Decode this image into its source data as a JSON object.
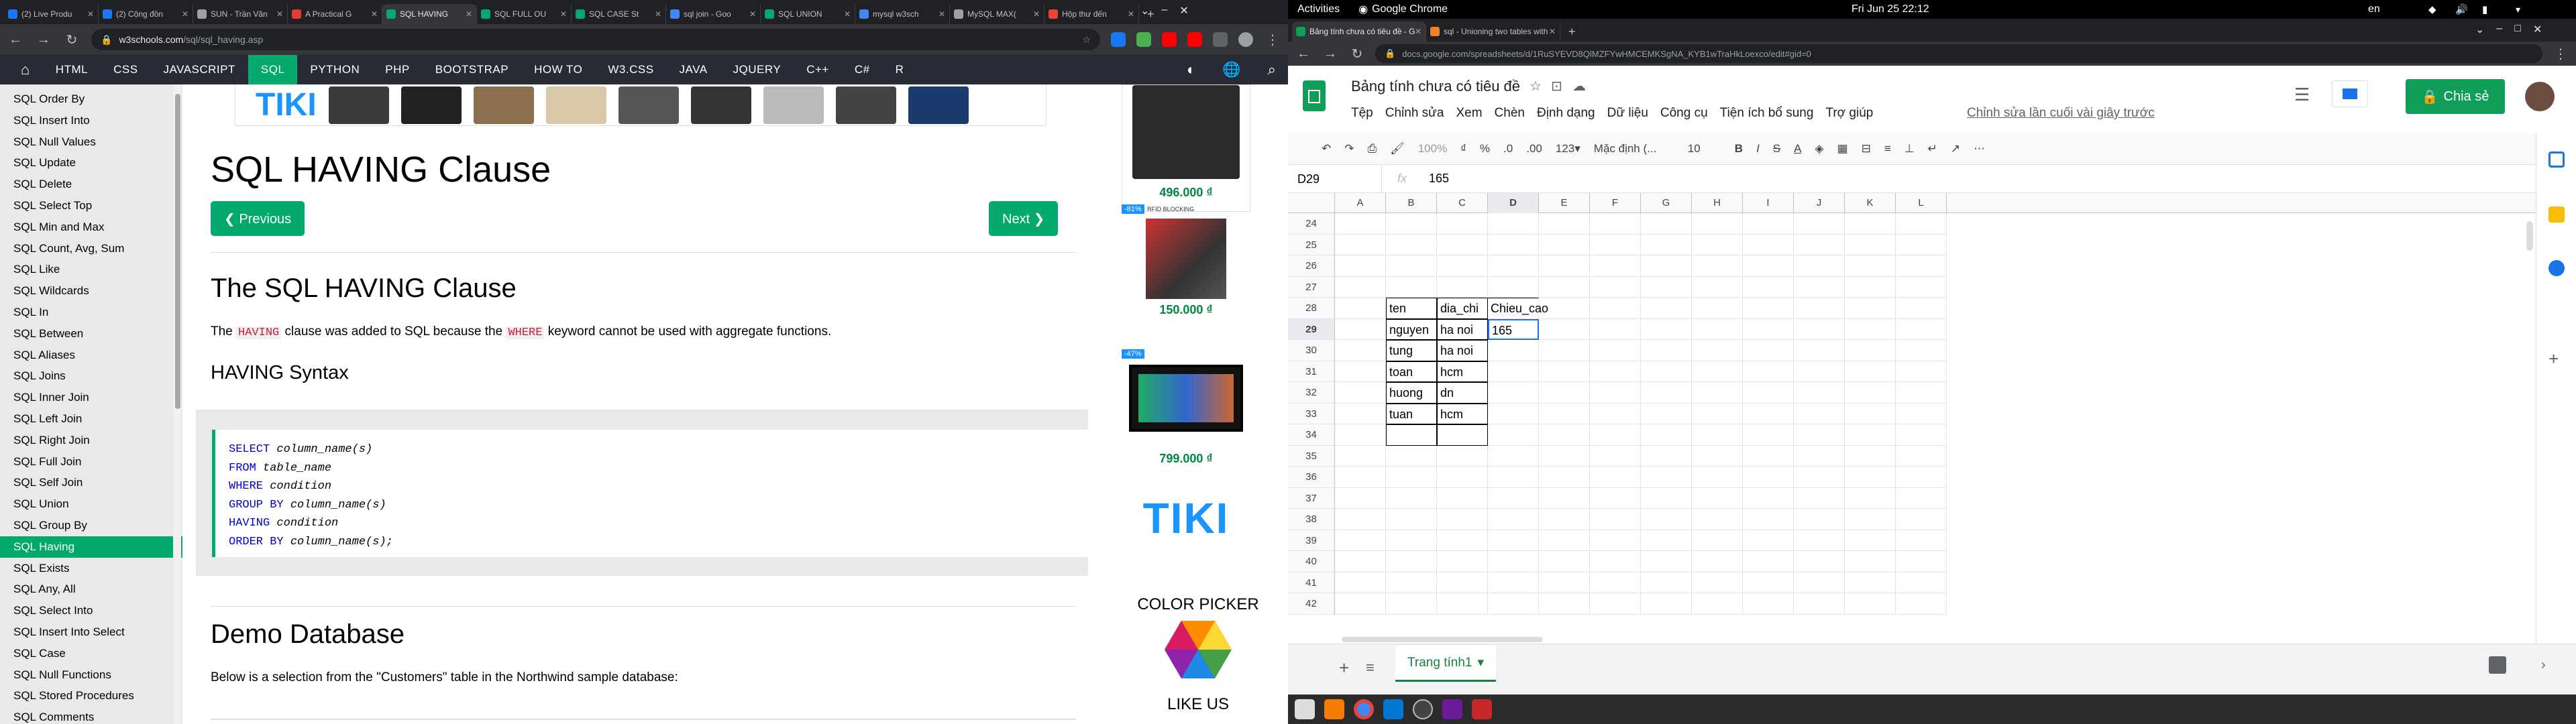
{
  "left_window": {
    "tabs": [
      {
        "title": "(2) Live Produ",
        "color": "#1877f2",
        "icon": "facebook-icon"
      },
      {
        "title": "(2) Cộng đồn",
        "color": "#1877f2",
        "icon": "facebook-icon"
      },
      {
        "title": "SUN - Trần Văn",
        "color": "#9aa0a6",
        "icon": "page-icon"
      },
      {
        "title": "A Practical G",
        "color": "#e53935",
        "icon": "article-icon"
      },
      {
        "title": "SQL HAVING",
        "color": "#04aa6d",
        "icon": "w3schools-icon",
        "active": true
      },
      {
        "title": "SQL FULL OU",
        "color": "#04aa6d",
        "icon": "w3schools-icon"
      },
      {
        "title": "SQL CASE St",
        "color": "#04aa6d",
        "icon": "w3schools-icon"
      },
      {
        "title": "sql join - Goo",
        "color": "#4285f4",
        "icon": "google-icon"
      },
      {
        "title": "SQL UNION",
        "color": "#04aa6d",
        "icon": "w3schools-icon"
      },
      {
        "title": "mysql w3sch",
        "color": "#4285f4",
        "icon": "google-icon"
      },
      {
        "title": "MySQL MAX(",
        "color": "#9aa0a6",
        "icon": "page-icon"
      },
      {
        "title": "Hộp thư đến",
        "color": "#ea4335",
        "icon": "gmail-icon"
      }
    ],
    "url_host": "w3schools.com",
    "url_path": "/sql/sql_having.asp",
    "nav": [
      "HTML",
      "CSS",
      "JAVASCRIPT",
      "SQL",
      "PYTHON",
      "PHP",
      "BOOTSTRAP",
      "HOW TO",
      "W3.CSS",
      "JAVA",
      "JQUERY",
      "C++",
      "C#",
      "R"
    ],
    "nav_active": "SQL",
    "sidebar": [
      "SQL Order By",
      "SQL Insert Into",
      "SQL Null Values",
      "SQL Update",
      "SQL Delete",
      "SQL Select Top",
      "SQL Min and Max",
      "SQL Count, Avg, Sum",
      "SQL Like",
      "SQL Wildcards",
      "SQL In",
      "SQL Between",
      "SQL Aliases",
      "SQL Joins",
      "SQL Inner Join",
      "SQL Left Join",
      "SQL Right Join",
      "SQL Full Join",
      "SQL Self Join",
      "SQL Union",
      "SQL Group By",
      "SQL Having",
      "SQL Exists",
      "SQL Any, All",
      "SQL Select Into",
      "SQL Insert Into Select",
      "SQL Case",
      "SQL Null Functions",
      "SQL Stored Procedures",
      "SQL Comments"
    ],
    "sidebar_active": "SQL Having",
    "page_title": "SQL HAVING Clause",
    "prev_label": "❮ Previous",
    "next_label": "Next ❯",
    "section1_title": "The SQL HAVING Clause",
    "para1_a": "The ",
    "para1_code1": "HAVING",
    "para1_b": " clause was added to SQL because the ",
    "para1_code2": "WHERE",
    "para1_c": " keyword cannot be used with aggregate functions.",
    "syntax_title": "HAVING Syntax",
    "code_lines": [
      {
        "kw": "SELECT",
        "rest": " column_name(s)"
      },
      {
        "kw": "FROM",
        "rest": " table_name"
      },
      {
        "kw": "WHERE",
        "rest": " condition"
      },
      {
        "kw": "GROUP BY",
        "rest": " column_name(s)"
      },
      {
        "kw": "HAVING",
        "rest": " condition"
      },
      {
        "kw": "ORDER BY",
        "rest": " column_name(s);"
      }
    ],
    "section2_title": "Demo Database",
    "para2": "Below is a selection from the \"Customers\" table in the Northwind sample database:",
    "ad_prices": [
      "496.000 ₫",
      "150.000 ₫",
      "799.000 ₫"
    ],
    "ad_badges": [
      "-81%",
      "-47%"
    ],
    "ad_badge_label": "RFID BLOCKING",
    "ad_brand": "TIKI",
    "color_picker_label": "COLOR PICKER",
    "like_us_label": "LIKE US"
  },
  "right_window": {
    "gnome_activities": "Activities",
    "gnome_app": "Google Chrome",
    "gnome_clock": "Fri Jun 25  22:12",
    "gnome_lang": "en",
    "tabs": [
      {
        "title": "Bảng tính chưa có tiêu đề - G",
        "active": true,
        "color": "#0f9d58"
      },
      {
        "title": "sql - Unioning two tables with",
        "active": false,
        "color": "#f48024"
      }
    ],
    "url": "docs.google.com/spreadsheets/d/1RuSYEVD8QlMZFYwHMCEMKSgNA_KYB1wTraHkLoexco/edit#gid=0",
    "doc_title": "Bảng tính chưa có tiêu đề",
    "menu": [
      "Tệp",
      "Chỉnh sửa",
      "Xem",
      "Chèn",
      "Định dạng",
      "Dữ liệu",
      "Công cụ",
      "Tiện ích bổ sung",
      "Trợ giúp"
    ],
    "last_edit": "Chỉnh sửa lần cuối vài giây trước",
    "share_label": "Chia sẻ",
    "toolbar": {
      "zoom": "100%",
      "currency": "₫",
      "percent": "%",
      "dec0": ".0",
      "dec00": ".00",
      "fmt123": "123▾",
      "font": "Mặc định (...",
      "size": "10"
    },
    "name_box": "D29",
    "formula": "165",
    "columns": [
      "A",
      "B",
      "C",
      "D",
      "E",
      "F",
      "G",
      "H",
      "I",
      "J",
      "K",
      "L"
    ],
    "rows": [
      "24",
      "25",
      "26",
      "27",
      "28",
      "29",
      "30",
      "31",
      "32",
      "33",
      "34",
      "35",
      "36",
      "37",
      "38",
      "39",
      "40",
      "41",
      "42"
    ],
    "cells": {
      "B28": "ten",
      "C28": "dia_chi",
      "D28": "Chieu_cao",
      "B29": "nguyen",
      "C29": "ha noi",
      "D29": "165",
      "B30": "tung",
      "C30": "ha noi",
      "B31": "toan",
      "C31": "hcm",
      "B32": "huong",
      "C32": "dn",
      "B33": "tuan",
      "C33": "hcm"
    },
    "sheet_tab": "Trang tính1"
  }
}
